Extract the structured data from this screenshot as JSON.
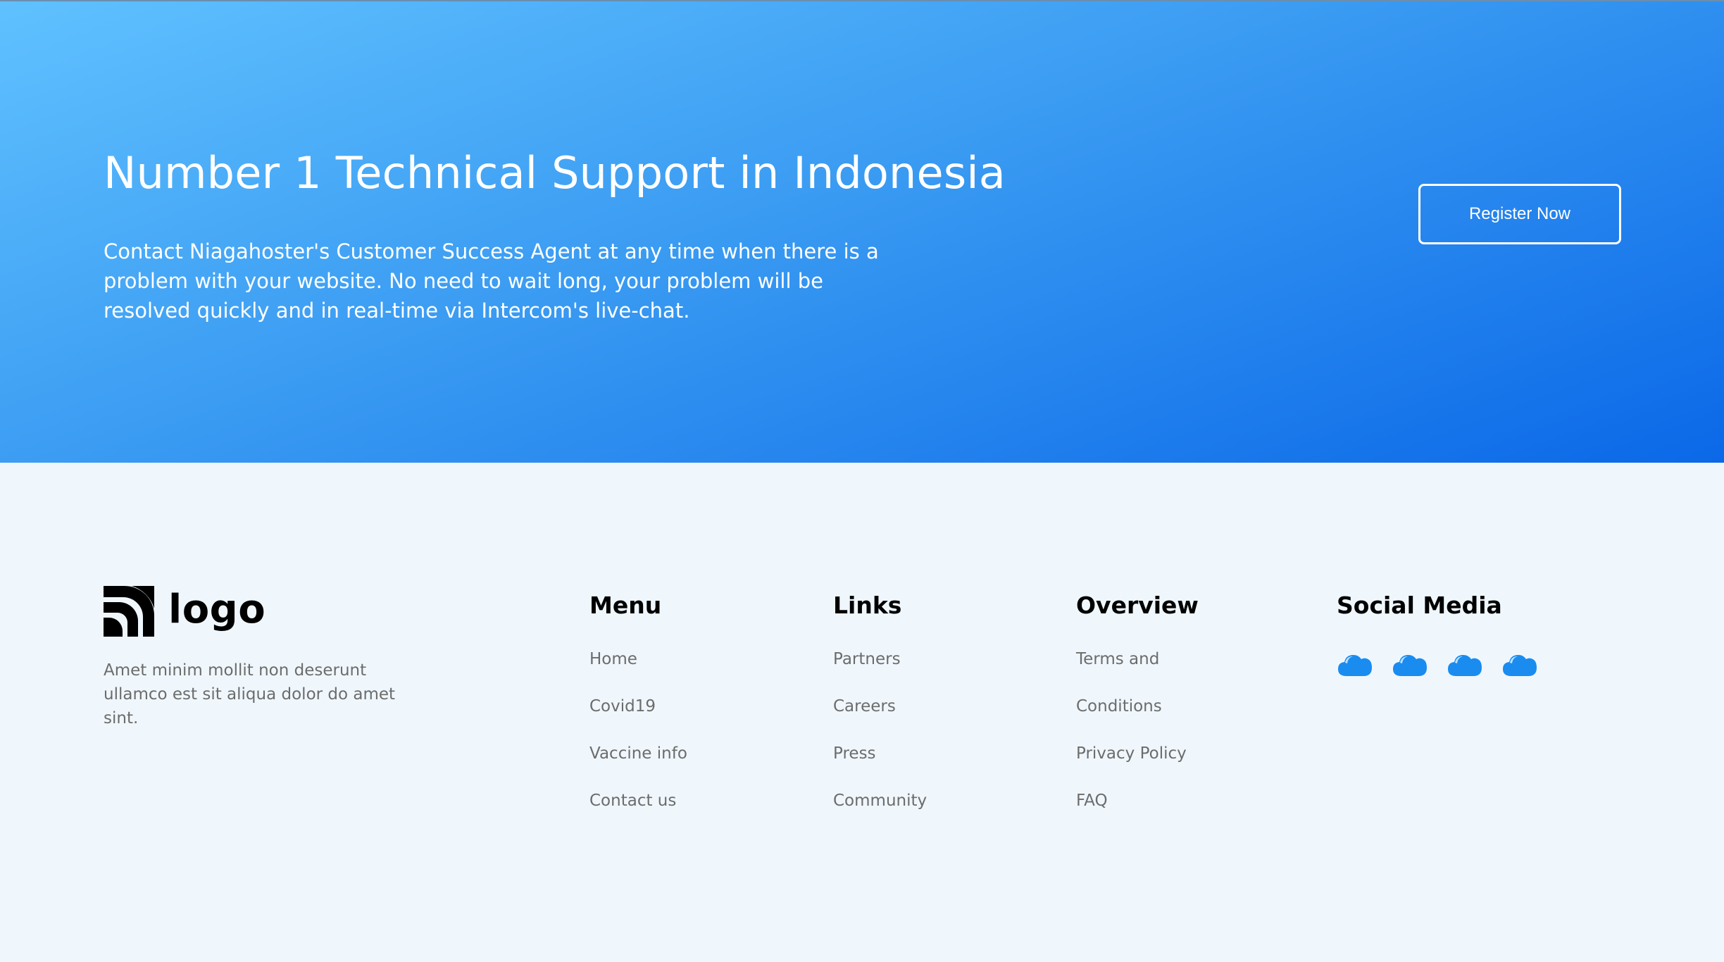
{
  "hero": {
    "title": "Number 1 Technical Support in Indonesia",
    "description": "Contact Niagahoster's Customer Success Agent at any time when there is a problem with your website. No need to wait long, your problem will be resolved quickly and in real-time via Intercom's live-chat.",
    "register_label": "Register Now"
  },
  "footer": {
    "logo_text": "logo",
    "about": "Amet minim mollit non deserunt ullamco est sit aliqua dolor do amet sint.",
    "menu": {
      "title": "Menu",
      "items": [
        "Home",
        "Covid19",
        "Vaccine info",
        "Contact us"
      ]
    },
    "links": {
      "title": "Links",
      "items": [
        "Partners",
        "Careers",
        "Press",
        "Community"
      ]
    },
    "overview": {
      "title": "Overview",
      "items": [
        "Terms and",
        "Conditions",
        "Privacy Policy",
        "FAQ"
      ]
    },
    "social": {
      "title": "Social Media",
      "icons": [
        "cloud-icon",
        "cloud-icon",
        "cloud-icon",
        "cloud-icon"
      ]
    }
  },
  "colors": {
    "hero_gradient_start": "#60c1ff",
    "hero_gradient_end": "#0b68e8",
    "footer_bg": "#eff7fd",
    "icon_blue": "#1a8cf0",
    "muted_text": "#6c6c6c"
  }
}
